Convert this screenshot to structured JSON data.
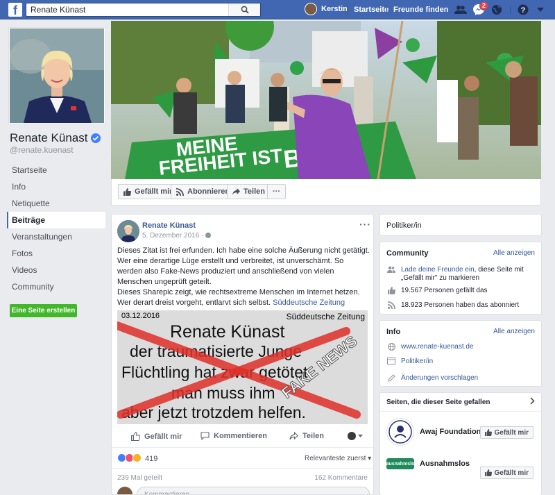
{
  "topbar": {
    "logo": "f",
    "search_value": "Renate Künast",
    "user_name": "Kerstin",
    "home_label": "Startseite",
    "find_friends_label": "Freunde finden",
    "messages_badge": "2"
  },
  "sidebar": {
    "page_name": "Renate Künast",
    "handle": "@renate.kuenast",
    "items": [
      {
        "label": "Startseite"
      },
      {
        "label": "Info"
      },
      {
        "label": "Netiquette"
      },
      {
        "label": "Beiträge"
      },
      {
        "label": "Veranstaltungen"
      },
      {
        "label": "Fotos"
      },
      {
        "label": "Videos"
      },
      {
        "label": "Community"
      }
    ],
    "active_item": "Beiträge",
    "create_page_label": "Eine Seite erstellen"
  },
  "cover": {
    "banner_text_1": "MEINE",
    "banner_text_2": "FREIHEIT IST",
    "banner_text_3": "BAR."
  },
  "actions": {
    "like_label": "Gefällt mir",
    "follow_label": "Abonnieren",
    "share_label": "Teilen",
    "more_label": "···"
  },
  "post": {
    "author": "Renate Künast",
    "date": "5. Dezember 2016 · ",
    "text_p1": "Dieses Zitat ist frei erfunden. Ich habe eine solche Äußerung nicht getätigt. Wer eine derartige Lüge erstellt und verbreitet, ist unverschämt. So werden also Fake-News produziert und anschließend von vielen Menschen ungeprüft geteilt.",
    "text_p2": "Dieses Sharepic zeigt, wie rechtsextreme Menschen im Internet hetzen. Wer derart dreist vorgeht, entlarvt sich selbst. ",
    "text_link": "Süddeutsche Zeitung",
    "image": {
      "date": "03.12.2016",
      "source": "Süddeutsche Zeitung",
      "line1": "Renate Künast",
      "line2": "der traumatisierte Junge",
      "line3": "Flüchtling hat zwar getötet",
      "line4": "man muss ihm",
      "line5": "aber jetzt trotzdem helfen.",
      "stamp": "FAKE NEWS"
    },
    "like_label": "Gefällt mir",
    "comment_label": "Kommentieren",
    "share_label": "Teilen",
    "reaction_count": "419",
    "sort_label": "Relevanteste zuerst ▾",
    "shares": "239 Mal geteilt",
    "comments": "162 Kommentare",
    "comment_placeholder": "Kommentieren ..."
  },
  "right": {
    "category": "Politiker/in",
    "community": {
      "title": "Community",
      "see_all": "Alle anzeigen",
      "invite_link": "Lade deine Freunde ein",
      "invite_rest": ", diese Seite mit „Gefällt mir\" zu markieren",
      "likes": "19.567 Personen gefällt das",
      "followers": "18.923 Personen haben das abonniert"
    },
    "info": {
      "title": "Info",
      "see_all": "Alle anzeigen",
      "website": "www.renate-kuenast.de",
      "category": "Politiker/in",
      "suggest": "Änderungen vorschlagen"
    },
    "liked_pages": {
      "title": "Seiten, die dieser Seite gefallen",
      "items": [
        {
          "name": "Awaj Foundation",
          "button": "Gefällt mir"
        },
        {
          "name": "Ausnahmslos",
          "logo_text": "#ausnahmslos",
          "button": "Gefällt mir"
        }
      ]
    }
  },
  "colors": {
    "brand": "#4267b2",
    "link": "#365899",
    "create_button": "#42b72a",
    "verified": "#4080ff",
    "fake_cross": "#e0302a"
  }
}
